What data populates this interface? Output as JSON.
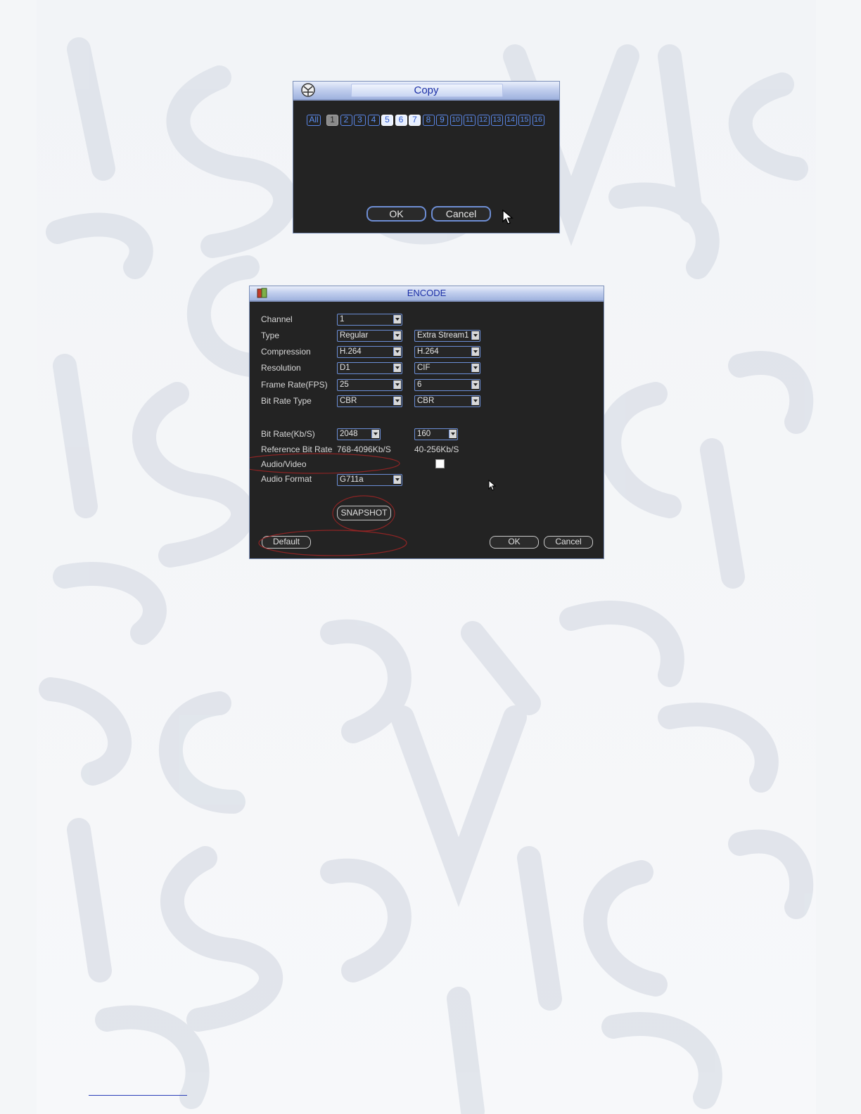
{
  "copy_dialog": {
    "title": "Copy",
    "all_label": "All",
    "channels": [
      "1",
      "2",
      "3",
      "4",
      "5",
      "6",
      "7",
      "8",
      "9",
      "10",
      "11",
      "12",
      "13",
      "14",
      "15",
      "16"
    ],
    "highlighted_channels": [
      "5",
      "6",
      "7"
    ],
    "greyed_channels": [
      "1"
    ],
    "ok_label": "OK",
    "cancel_label": "Cancel"
  },
  "encode_dialog": {
    "title": "ENCODE",
    "labels": {
      "channel": "Channel",
      "type": "Type",
      "compression": "Compression",
      "resolution": "Resolution",
      "frame_rate": "Frame Rate(FPS)",
      "bit_rate_type": "Bit Rate Type",
      "bit_rate": "Bit Rate(Kb/S)",
      "reference_bit_rate": "Reference Bit Rate",
      "audio_video": "Audio/Video",
      "audio_format": "Audio Format"
    },
    "main": {
      "channel": "1",
      "type": "Regular",
      "compression": "H.264",
      "resolution": "D1",
      "frame_rate": "25",
      "bit_rate_type": "CBR",
      "bit_rate": "2048",
      "reference_bit_rate": "768-4096Kb/S",
      "audio_format": "G711a"
    },
    "extra": {
      "type": "Extra Stream1",
      "compression": "H.264",
      "resolution": "CIF",
      "frame_rate": "6",
      "bit_rate_type": "CBR",
      "bit_rate": "160",
      "reference_bit_rate": "40-256Kb/S",
      "audio_video_checked": false
    },
    "snapshot_label": "SNAPSHOT",
    "default_label": "Default",
    "ok_label": "OK",
    "cancel_label": "Cancel",
    "annotation_color": "#b02a2a"
  }
}
